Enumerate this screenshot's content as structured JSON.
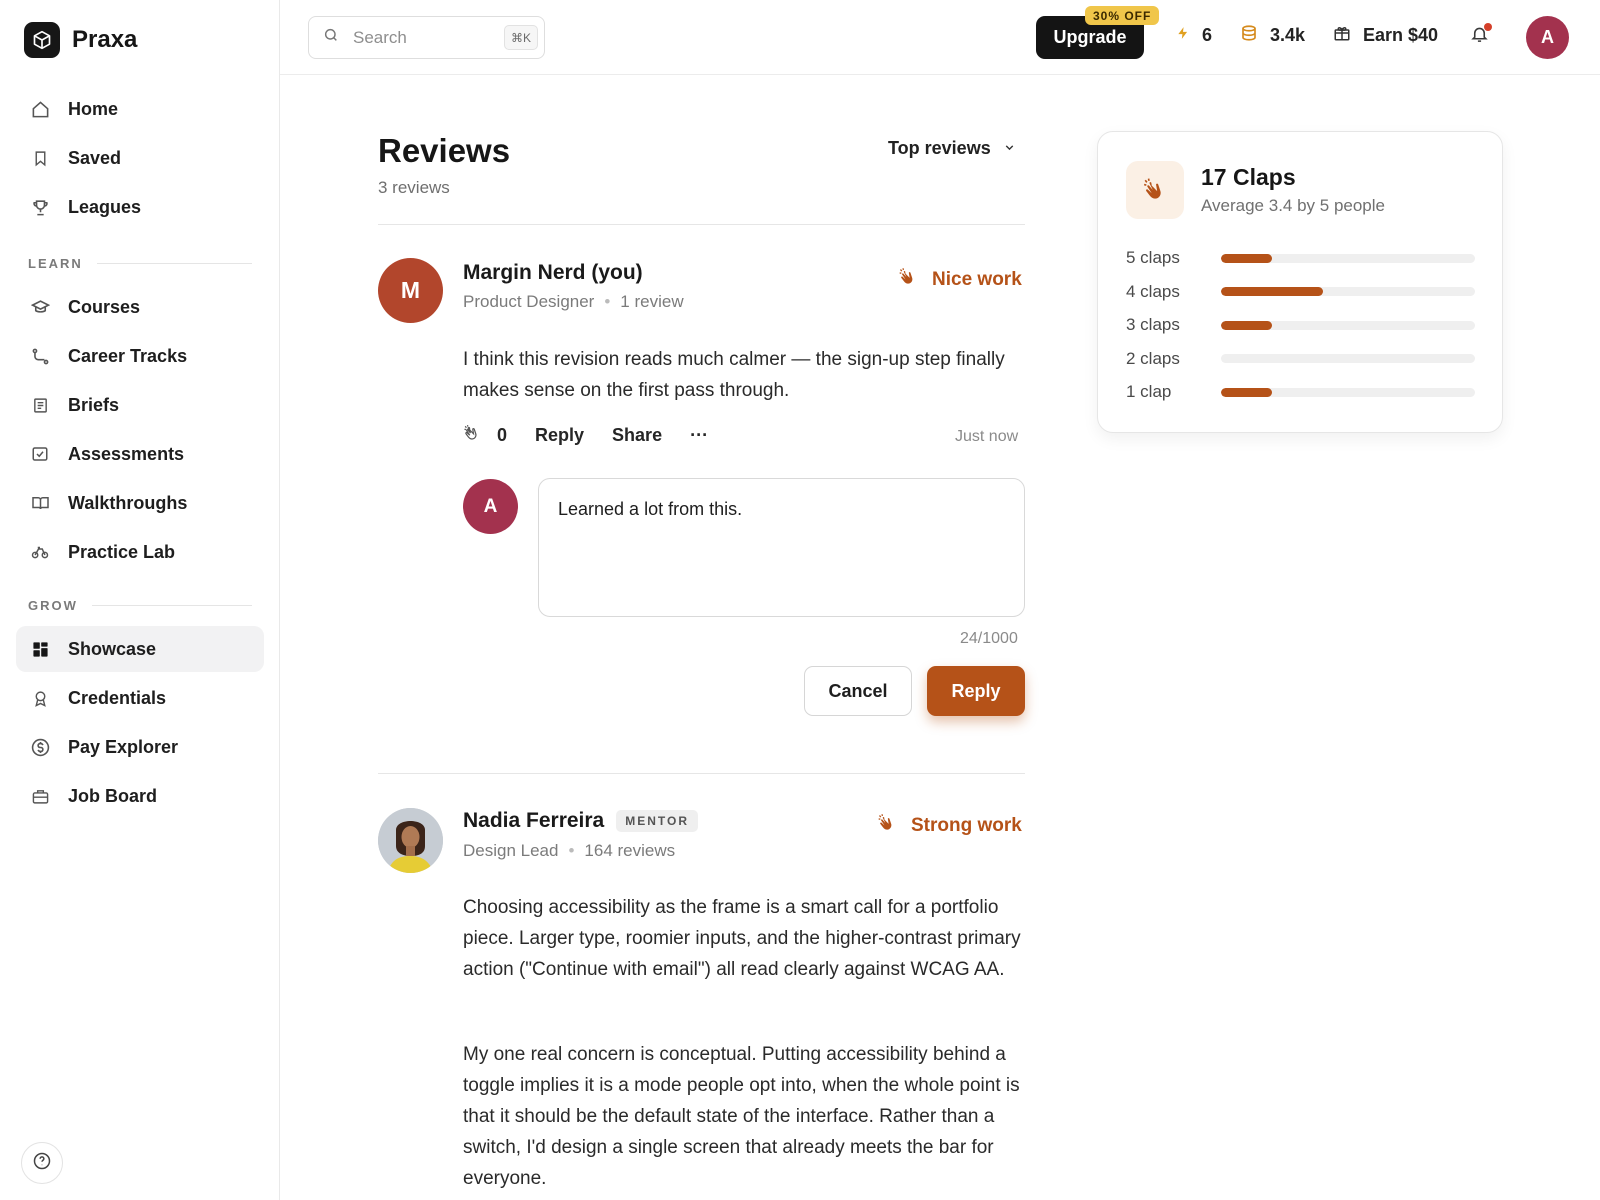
{
  "brand": {
    "name": "Praxa"
  },
  "sidebar": {
    "main_items": [
      {
        "label": "Home",
        "icon": "home-icon"
      },
      {
        "label": "Saved",
        "icon": "bookmark-icon"
      },
      {
        "label": "Leagues",
        "icon": "trophy-icon"
      }
    ],
    "learn_label": "LEARN",
    "learn_items": [
      {
        "label": "Courses",
        "icon": "graduation-cap-icon"
      },
      {
        "label": "Career Tracks",
        "icon": "route-icon"
      },
      {
        "label": "Briefs",
        "icon": "document-icon"
      },
      {
        "label": "Assessments",
        "icon": "check-square-icon"
      },
      {
        "label": "Walkthroughs",
        "icon": "book-open-icon"
      },
      {
        "label": "Practice Lab",
        "icon": "bicycle-icon"
      }
    ],
    "grow_label": "GROW",
    "grow_items": [
      {
        "label": "Showcase",
        "icon": "grid-icon",
        "active": true
      },
      {
        "label": "Credentials",
        "icon": "award-icon"
      },
      {
        "label": "Pay Explorer",
        "icon": "dollar-circle-icon"
      },
      {
        "label": "Job Board",
        "icon": "briefcase-icon"
      }
    ]
  },
  "topbar": {
    "search_placeholder": "Search",
    "search_shortcut": "⌘K",
    "upgrade_label": "Upgrade",
    "upgrade_badge": "30% OFF",
    "streak": "6",
    "coins": "3.4k",
    "earn": "Earn $40",
    "user_initial": "A"
  },
  "reviews": {
    "title": "Reviews",
    "count": "3 reviews",
    "sort_label": "Top reviews",
    "items": [
      {
        "initial": "M",
        "name": "Margin Nerd (you)",
        "role": "Product Designer",
        "review_count": "1 review",
        "praise": "Nice work",
        "body": "I think this revision reads much calmer — the sign-up step finally makes sense on the first pass through.",
        "claps": "0",
        "reply_label": "Reply",
        "share_label": "Share",
        "more_label": "···",
        "time": "Just now"
      },
      {
        "name": "Nadia Ferreira",
        "badge": "MENTOR",
        "role": "Design Lead",
        "review_count": "164 reviews",
        "praise": "Strong work",
        "body_1": "Choosing accessibility as the frame is a smart call for a portfolio piece. Larger type, roomier inputs, and the higher-contrast primary action (\"Continue with email\") all read clearly against WCAG AA.",
        "body_2": "My one real concern is conceptual. Putting accessibility behind a toggle implies it is a mode people opt into, when the whole point is that it should be the default state of the interface. Rather than a switch, I'd design a single screen that already meets the bar for everyone."
      }
    ]
  },
  "reply": {
    "user_initial": "A",
    "value": "Learned a lot from this.",
    "char_count": "24/1000",
    "cancel_label": "Cancel",
    "submit_label": "Reply"
  },
  "summary": {
    "title": "17 Claps",
    "subtitle": "Average 3.4 by 5 people",
    "distribution": [
      {
        "label": "5 claps",
        "fraction": 0.2
      },
      {
        "label": "4 claps",
        "fraction": 0.4
      },
      {
        "label": "3 claps",
        "fraction": 0.2
      },
      {
        "label": "2 claps",
        "fraction": 0.0
      },
      {
        "label": "1 clap",
        "fraction": 0.2
      }
    ]
  },
  "colors": {
    "accent": "#b55218",
    "avatar_user": "#a3324e",
    "avatar_margin": "#b2462c"
  }
}
